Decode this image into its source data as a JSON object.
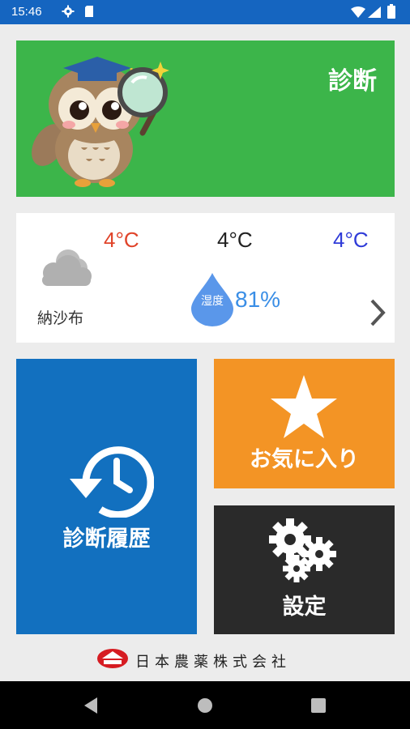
{
  "status_bar": {
    "time": "15:46",
    "icons": [
      "gear-icon",
      "sim-card-icon",
      "wifi-icon",
      "signal-icon",
      "battery-icon"
    ]
  },
  "diagnosis": {
    "label": "診断",
    "color": "#3cb54a",
    "mascot": "owl-with-magnifier-illustration"
  },
  "weather": {
    "temp_high": "4°C",
    "temp_current": "4°C",
    "temp_low": "4°C",
    "location": "納沙布",
    "humidity_label": "湿度",
    "humidity_value": "81%",
    "condition_icon": "cloud-icon"
  },
  "tiles": {
    "history": {
      "label": "診断履歴",
      "icon": "history-clock-icon",
      "color": "#1270bf"
    },
    "favorites": {
      "label": "お気に入り",
      "icon": "star-icon",
      "color": "#f39425"
    },
    "settings": {
      "label": "設定",
      "icon": "gears-icon",
      "color": "#2a2a2a"
    }
  },
  "footer": {
    "company": "日本農薬株式会社",
    "logo": "company-logo"
  },
  "nav_bar": {
    "buttons": [
      "back-icon",
      "home-icon",
      "recents-icon"
    ]
  }
}
